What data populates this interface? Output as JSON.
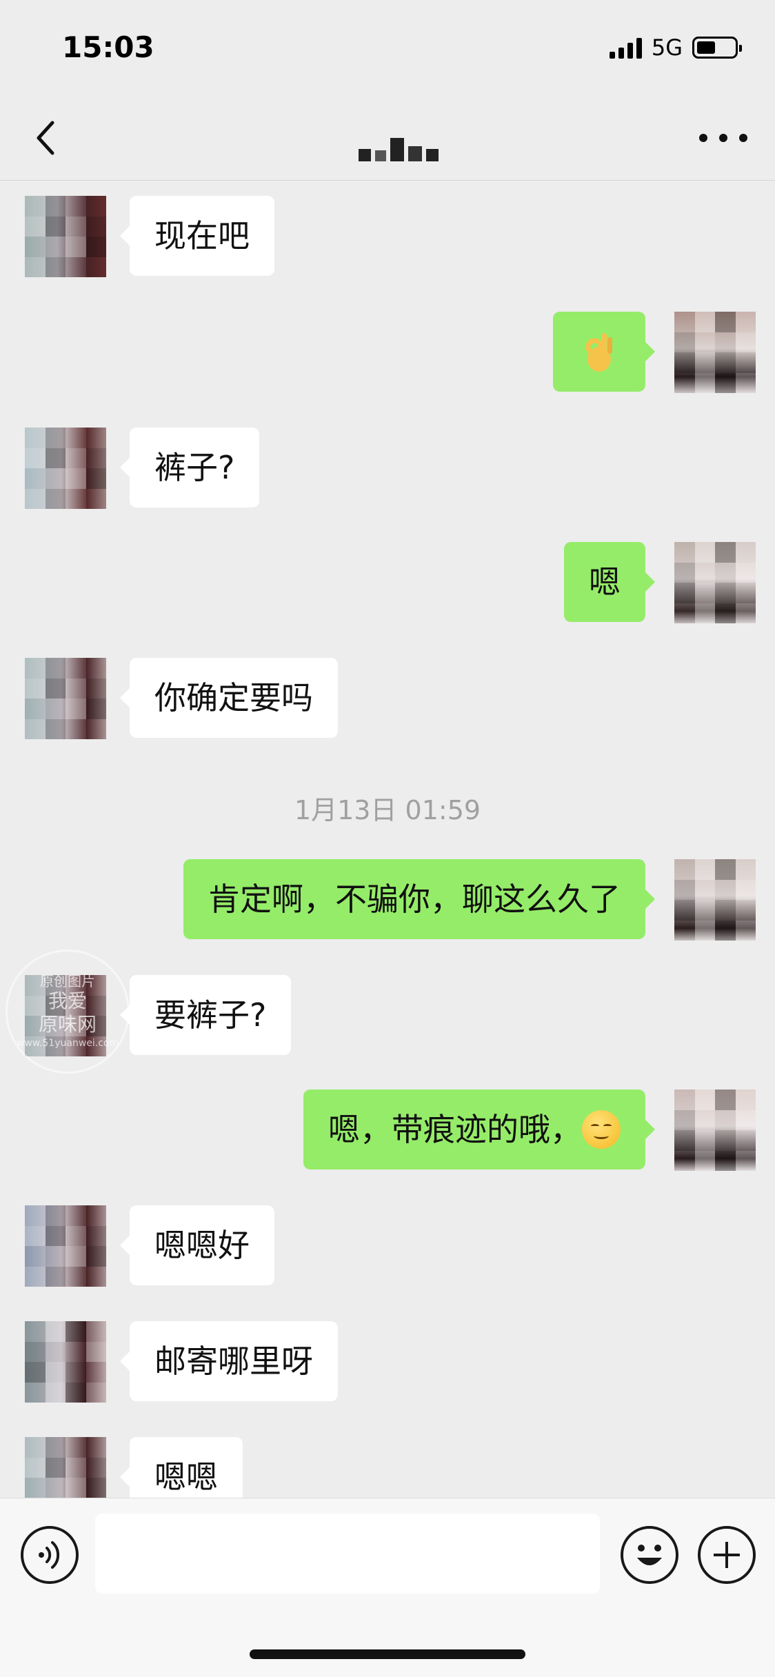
{
  "status_bar": {
    "time": "15:03",
    "network": "5G",
    "battery_level": 0.5,
    "signal_bars": 4
  },
  "nav": {
    "back_icon": "chevron-left-icon",
    "more_icon": "more-horizontal-icon"
  },
  "messages": [
    {
      "side": "left",
      "text": "现在吧"
    },
    {
      "side": "right",
      "emoji": "ok-hand-emoji"
    },
    {
      "side": "left",
      "text": "裤子?"
    },
    {
      "side": "right",
      "text": "嗯"
    },
    {
      "side": "left",
      "text": "你确定要吗"
    },
    {
      "side": "right",
      "text": "肯定啊，不骗你，聊这么久了"
    },
    {
      "side": "left",
      "text": "要裤子?"
    },
    {
      "side": "right",
      "text": "嗯，带痕迹的哦，"
    },
    {
      "side": "left",
      "text": "嗯嗯好"
    },
    {
      "side": "left",
      "text": "邮寄哪里呀"
    },
    {
      "side": "left",
      "text": "嗯嗯"
    }
  ],
  "timestamp": "1月13日 01:59",
  "watermark": {
    "line1": "原创图片",
    "line2": "我爱",
    "line3": "原味网",
    "line4": "www.51yuanwei.com"
  },
  "input": {
    "value": "",
    "voice_icon": "voice-icon",
    "emoji_icon": "emoji-icon",
    "plus_icon": "plus-icon"
  },
  "colors": {
    "background": "#ededed",
    "sent_bubble": "#95ec69",
    "received_bubble": "#ffffff",
    "timestamp": "#a0a0a0"
  }
}
